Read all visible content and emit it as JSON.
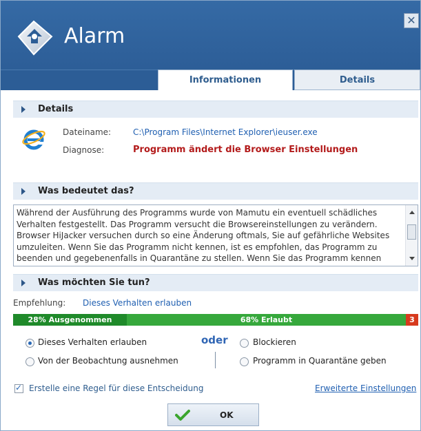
{
  "window": {
    "title": "Alarm",
    "close_glyph": "✕"
  },
  "tabs": [
    {
      "label": "Informationen",
      "active": true
    },
    {
      "label": "Details",
      "active": false
    }
  ],
  "details_section": {
    "title": "Details",
    "icon": "internet-explorer-icon",
    "file_label": "Dateiname:",
    "file_value": "C:\\Program Files\\Internet Explorer\\ieuser.exe",
    "diagnosis_label": "Diagnose:",
    "diagnosis_value": "Programm ändert die Browser Einstellungen"
  },
  "meaning_section": {
    "title": "Was bedeutet das?",
    "text": "Während der Ausführung des Programms wurde von Mamutu ein eventuell schädliches Verhalten festgestellt. Das Programm versucht die Browsereinstellungen zu verändern. Browser HiJacker versuchen durch so eine Änderung oftmals, Sie auf gefährliche Websites umzuleiten. Wenn Sie das Programm nicht kennen, ist es empfohlen, das Programm zu beenden und gegebenenfalls in Quarantäne zu stellen. Wenn Sie das Programm kennen"
  },
  "action_section": {
    "title": "Was möchten Sie tun?",
    "recommendation_label": "Empfehlung:",
    "recommendation_value": "Dieses Verhalten erlauben",
    "community_bar": {
      "excluded_label": "28% Ausgenommen",
      "excluded_fraction": 0.28,
      "allowed_label": "68% Erlaubt",
      "allowed_fraction": 0.68,
      "blocked_label": "3",
      "blocked_fraction": 0.03,
      "colors": {
        "excluded": "#1f8a2a",
        "allowed": "#36a83c",
        "blocked": "#d73a1e"
      }
    },
    "or_label": "oder",
    "options": [
      {
        "label": "Dieses Verhalten erlauben",
        "checked": true
      },
      {
        "label": "Von der Beobachtung ausnehmen",
        "checked": false
      },
      {
        "label": "Blockieren",
        "checked": false
      },
      {
        "label": "Programm in Quarantäne geben",
        "checked": false
      }
    ]
  },
  "footer": {
    "create_rule_label": "Erstelle eine Regel für diese Entscheidung",
    "create_rule_checked": true,
    "advanced_link": "Erweiterte Einstellungen",
    "ok_label": "OK"
  },
  "colors": {
    "accent": "#2c5d96",
    "link": "#1f5fb1",
    "alert": "#b31b1b"
  }
}
